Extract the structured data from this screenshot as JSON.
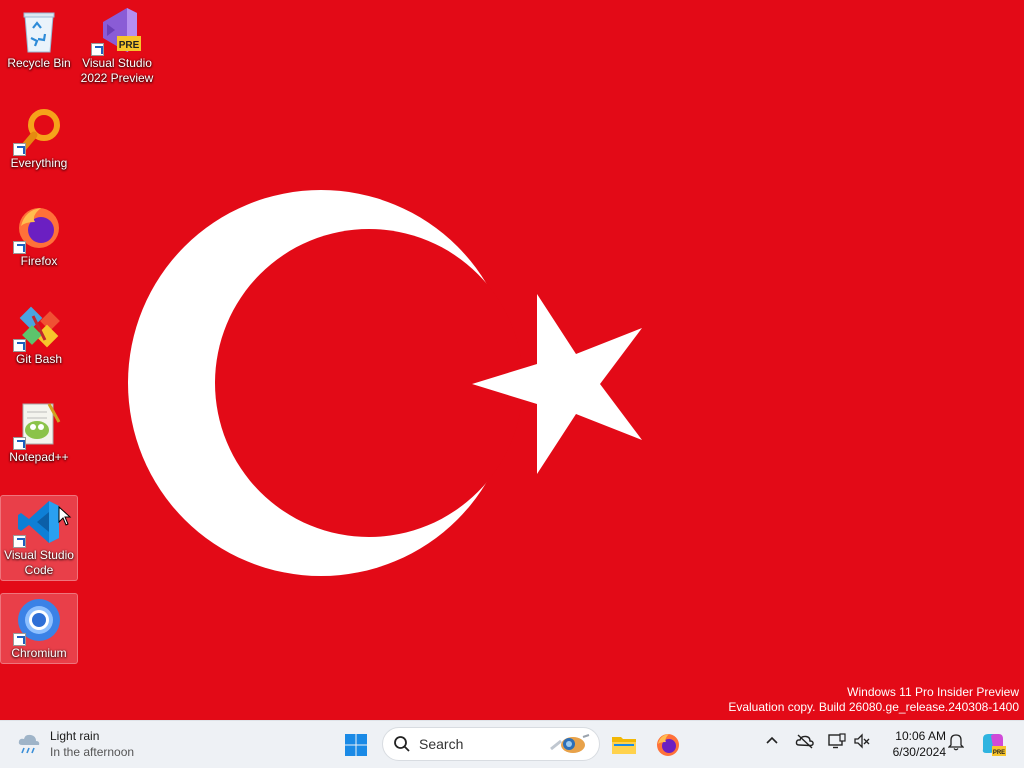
{
  "desktop": {
    "icons": [
      {
        "label": "Recycle Bin"
      },
      {
        "label": "Visual Studio 2022 Preview",
        "badge": "PRE"
      },
      {
        "label": "Everything"
      },
      {
        "label": "Firefox"
      },
      {
        "label": "Git Bash"
      },
      {
        "label": "Notepad++"
      },
      {
        "label": "Visual Studio Code"
      },
      {
        "label": "Chromium"
      }
    ],
    "watermark": {
      "line1": "Windows 11 Pro Insider Preview",
      "line2": "Evaluation copy. Build 26080.ge_release.240308-1400"
    },
    "wallpaper_colors": {
      "red": "#e30a17",
      "white": "#ffffff"
    }
  },
  "taskbar": {
    "weather": {
      "line1": "Light rain",
      "line2": "In the afternoon",
      "icon": "rain-cloud-icon"
    },
    "search": {
      "placeholder": "Search"
    },
    "pinned": [
      {
        "name": "windows-start-icon"
      },
      {
        "name": "file-explorer-icon"
      },
      {
        "name": "firefox-icon"
      }
    ],
    "tray": {
      "time": "10:06 AM",
      "date": "6/30/2024"
    },
    "colors": {
      "background": "#eef1f5",
      "accent": "#0078d4"
    }
  }
}
